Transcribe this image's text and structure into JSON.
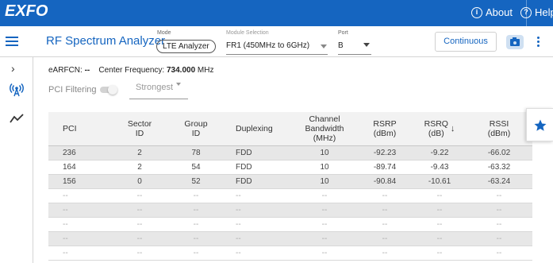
{
  "topbar": {
    "logo": "EXFO",
    "about_label": "About",
    "help_label": "Help",
    "bg_color": "#1565c0"
  },
  "toolbar": {
    "title": "RF Spectrum Analyzer",
    "mode_label": "Mode",
    "mode_value": "LTE Analyzer",
    "module_label": "Module Selection",
    "module_value": "FR1 (450MHz to 6GHz)",
    "port_label": "Port",
    "port_value": "B",
    "continuous_label": "Continuous"
  },
  "info": {
    "earfcn_label": "eARFCN:",
    "earfcn_value": "--",
    "center_label": "Center Frequency:",
    "center_value": "734.000",
    "center_unit": "MHz"
  },
  "filter": {
    "pci_filtering_label": "PCI Filtering",
    "pci_filtering_on": false,
    "strongest_value": "Strongest"
  },
  "table": {
    "headers": {
      "pci": "PCI",
      "sector_1": "Sector",
      "sector_2": "ID",
      "group_1": "Group",
      "group_2": "ID",
      "duplexing": "Duplexing",
      "bw_1": "Channel",
      "bw_2": "Bandwidth",
      "bw_3": "(MHz)",
      "rsrp_1": "RSRP",
      "rsrp_2": "(dBm)",
      "rsrq_1": "RSRQ",
      "rsrq_2": "(dB)",
      "rssi_1": "RSSI",
      "rssi_2": "(dBm)"
    },
    "rows": [
      {
        "pci": "236",
        "sector": "2",
        "group": "78",
        "dup": "FDD",
        "bw": "10",
        "rsrp": "-92.23",
        "rsrq": "-9.22",
        "rssi": "-66.02"
      },
      {
        "pci": "164",
        "sector": "2",
        "group": "54",
        "dup": "FDD",
        "bw": "10",
        "rsrp": "-89.74",
        "rsrq": "-9.43",
        "rssi": "-63.32"
      },
      {
        "pci": "156",
        "sector": "0",
        "group": "52",
        "dup": "FDD",
        "bw": "10",
        "rsrp": "-90.84",
        "rsrq": "-10.61",
        "rssi": "-63.24"
      },
      {
        "pci": "--",
        "sector": "--",
        "group": "--",
        "dup": "--",
        "bw": "--",
        "rsrp": "--",
        "rsrq": "--",
        "rssi": "--"
      },
      {
        "pci": "--",
        "sector": "--",
        "group": "--",
        "dup": "--",
        "bw": "--",
        "rsrp": "--",
        "rsrq": "--",
        "rssi": "--"
      },
      {
        "pci": "--",
        "sector": "--",
        "group": "--",
        "dup": "--",
        "bw": "--",
        "rsrp": "--",
        "rsrq": "--",
        "rssi": "--"
      },
      {
        "pci": "--",
        "sector": "--",
        "group": "--",
        "dup": "--",
        "bw": "--",
        "rsrp": "--",
        "rsrq": "--",
        "rssi": "--"
      },
      {
        "pci": "--",
        "sector": "--",
        "group": "--",
        "dup": "--",
        "bw": "--",
        "rsrp": "--",
        "rsrq": "--",
        "rssi": "--"
      }
    ]
  }
}
